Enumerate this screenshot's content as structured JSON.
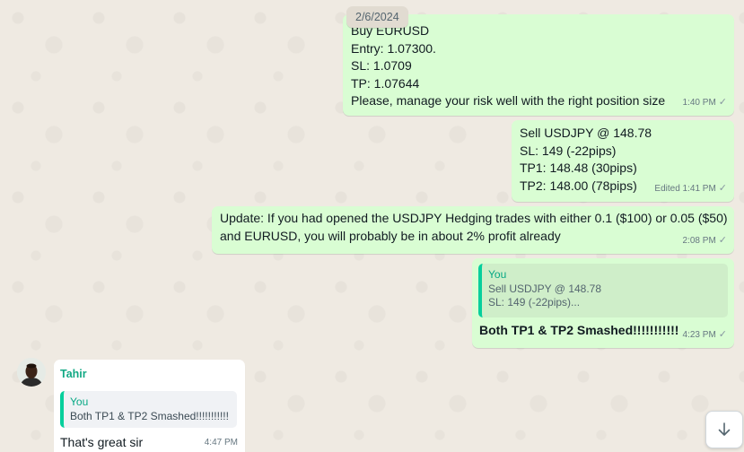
{
  "date_chip": "2/6/2024",
  "messages": [
    {
      "lines": [
        "Buy EURUSD",
        "Entry: 1.07300.",
        "SL: 1.0709",
        "TP: 1.07644",
        "Please, manage your risk well with the right position size"
      ],
      "time": "1:40 PM"
    },
    {
      "lines": [
        "Sell USDJPY @ 148.78",
        "SL: 149 (-22pips)",
        "TP1: 148.48 (30pips)",
        "TP2: 148.00 (78pips)"
      ],
      "time": "Edited 1:41 PM"
    },
    {
      "lines": [
        "Update: If you had opened the USDJPY Hedging trades with either 0.1 ($100) or 0.05 ($50)",
        "and EURUSD, you will probably be in about 2% profit already"
      ],
      "time": "2:08 PM"
    },
    {
      "quote": {
        "author": "You",
        "lines": [
          "Sell USDJPY @ 148.78",
          "SL: 149 (-22pips)..."
        ]
      },
      "text": "Both TP1 & TP2 Smashed!!!!!!!!!!!",
      "time": "4:23 PM"
    },
    {
      "sender": "Tahir",
      "quote": {
        "author": "You",
        "text": "Both TP1 & TP2 Smashed!!!!!!!!!!!"
      },
      "text": "That's great sir",
      "time": "4:47 PM"
    }
  ],
  "tick_glyph": "✓",
  "icons": {
    "scroll": "arrow-down-icon",
    "avatar": "contact-avatar"
  },
  "colors": {
    "outgoing": "#d9fdd3",
    "incoming": "#ffffff",
    "accent": "#06cf9c"
  }
}
